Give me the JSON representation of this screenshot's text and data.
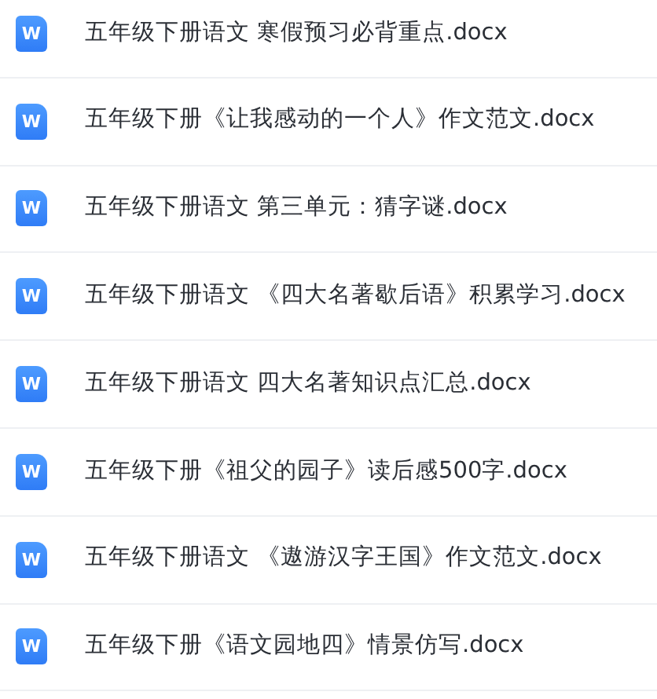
{
  "files": [
    {
      "icon_label": "W",
      "name": "五年级下册语文 寒假预习必背重点.docx"
    },
    {
      "icon_label": "W",
      "name": "五年级下册《让我感动的一个人》作文范文.docx"
    },
    {
      "icon_label": "W",
      "name": "五年级下册语文 第三单元：猜字谜.docx"
    },
    {
      "icon_label": "W",
      "name": "五年级下册语文 《四大名著歇后语》积累学习.docx"
    },
    {
      "icon_label": "W",
      "name": "五年级下册语文 四大名著知识点汇总.docx"
    },
    {
      "icon_label": "W",
      "name": "五年级下册《祖父的园子》读后感500字.docx"
    },
    {
      "icon_label": "W",
      "name": "五年级下册语文 《遨游汉字王国》作文范文.docx"
    },
    {
      "icon_label": "W",
      "name": "五年级下册《语文园地四》情景仿写.docx"
    }
  ]
}
